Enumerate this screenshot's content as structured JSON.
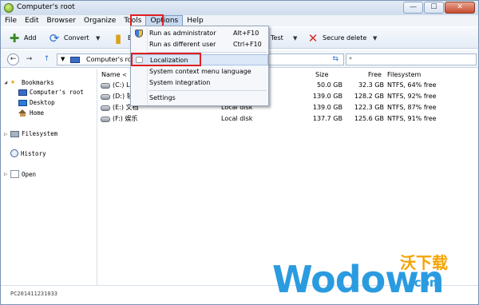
{
  "window": {
    "title": "Computer's root"
  },
  "window_controls": {
    "minimize": "—",
    "maximize": "☐",
    "close": "✕"
  },
  "menu": [
    "File",
    "Edit",
    "Browser",
    "Organize",
    "Tools",
    "Options",
    "Help"
  ],
  "toolbar": {
    "add": "Add",
    "convert": "Convert",
    "test": "Test",
    "secure_delete": "Secure delete",
    "hidden_label": "E"
  },
  "address": {
    "path": "Computer's ro",
    "search": "*"
  },
  "sidebar": {
    "bookmarks": "Bookmarks",
    "computers_root": "Computer's root",
    "desktop": "Desktop",
    "home": "Home",
    "filesystem": "Filesystem",
    "history": "History",
    "open": "Open"
  },
  "columns": {
    "name": "Name",
    "size": "Size",
    "free": "Free",
    "filesystem": "Filesystem"
  },
  "drives": [
    {
      "name": "(C:) Lo",
      "type": "",
      "size": "50.0 GB",
      "free": "32.3 GB",
      "fs": "NTFS, 64% free"
    },
    {
      "name": "(D:) 软",
      "type": "",
      "size": "139.0 GB",
      "free": "128.2 GB",
      "fs": "NTFS, 92% free"
    },
    {
      "name": "(E:) 文档",
      "type": "Local disk",
      "size": "139.0 GB",
      "free": "122.3 GB",
      "fs": "NTFS, 87% free"
    },
    {
      "name": "(F:) 娱乐",
      "type": "Local disk",
      "size": "137.7 GB",
      "free": "125.6 GB",
      "fs": "NTFS, 91% free"
    }
  ],
  "options_menu": {
    "run_admin": "Run as administrator",
    "run_admin_shortcut": "Alt+F10",
    "run_other": "Run as different user",
    "run_other_shortcut": "Ctrl+F10",
    "localization": "Localization",
    "system_context": "System context menu language",
    "system_integration": "System integration",
    "settings": "Settings"
  },
  "status": {
    "machine": "PC201411231033"
  },
  "watermark": {
    "cn": "沃下载",
    "main": "Wodown",
    "suffix": ".com"
  },
  "colors": {
    "highlight_box": "#e02020",
    "menu_highlight": "#dce8f7",
    "watermark_blue": "#2b9be0",
    "watermark_orange": "#f5a300"
  }
}
